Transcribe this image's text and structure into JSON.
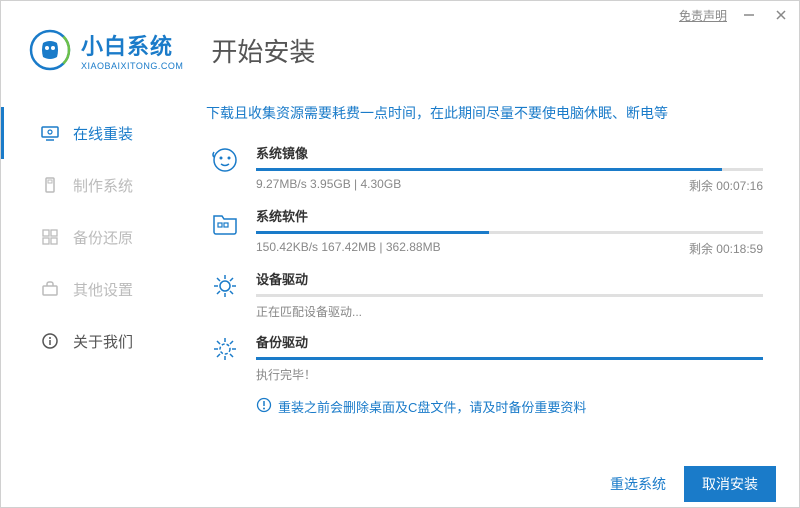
{
  "titlebar": {
    "disclaimer": "免责声明"
  },
  "brand": {
    "title": "小白系统",
    "sub": "XIAOBAIXITONG.COM"
  },
  "page_title": "开始安装",
  "sidebar": {
    "items": [
      {
        "label": "在线重装"
      },
      {
        "label": "制作系统"
      },
      {
        "label": "备份还原"
      },
      {
        "label": "其他设置"
      },
      {
        "label": "关于我们"
      }
    ]
  },
  "hint": "下载且收集资源需要耗费一点时间，在此期间尽量不要使电脑休眠、断电等",
  "tasks": [
    {
      "name": "系统镜像",
      "detail": "9.27MB/s 3.95GB | 4.30GB",
      "remaining": "剩余 00:07:16",
      "progress": 92
    },
    {
      "name": "系统软件",
      "detail": "150.42KB/s 167.42MB | 362.88MB",
      "remaining": "剩余 00:18:59",
      "progress": 46
    },
    {
      "name": "设备驱动",
      "detail": "正在匹配设备驱动...",
      "remaining": "",
      "progress": 0
    },
    {
      "name": "备份驱动",
      "detail": "执行完毕！",
      "remaining": "",
      "progress": 100
    }
  ],
  "warning": "重装之前会删除桌面及C盘文件，请及时备份重要资料",
  "footer": {
    "reselect": "重选系统",
    "cancel": "取消安装"
  }
}
